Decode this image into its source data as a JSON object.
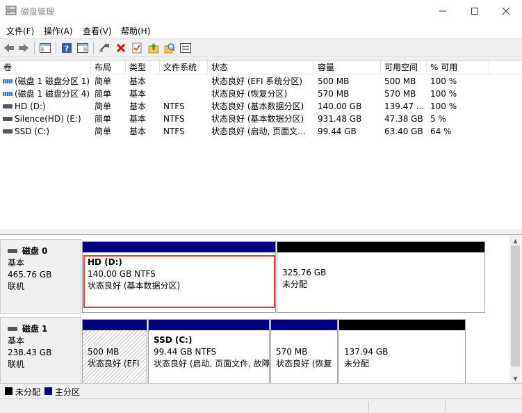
{
  "window": {
    "title": "磁盘管理",
    "icon": "disk-management-icon"
  },
  "menu": [
    "文件(F)",
    "操作(A)",
    "查看(V)",
    "帮助(H)"
  ],
  "toolbar": {
    "buttons": [
      "back-arrow-icon",
      "forward-arrow-icon",
      "console-tree-icon",
      "help-icon",
      "properties-icon",
      "connect-disk-icon",
      "delete-icon",
      "check-icon",
      "up-folder-icon",
      "search-icon",
      "list-icon"
    ]
  },
  "volume_table": {
    "columns": [
      "卷",
      "布局",
      "类型",
      "文件系统",
      "状态",
      "容量",
      "可用空间",
      "% 可用"
    ],
    "rows": [
      {
        "volume": "(磁盘 1 磁盘分区 1)",
        "layout": "简单",
        "type": "基本",
        "fs": "",
        "status": "状态良好 (EFI 系统分区)",
        "capacity": "500 MB",
        "free": "500 MB",
        "pct": "100 %",
        "icon": "system-partition-icon"
      },
      {
        "volume": "(磁盘 1 磁盘分区 4)",
        "layout": "简单",
        "type": "基本",
        "fs": "",
        "status": "状态良好 (恢复分区)",
        "capacity": "570 MB",
        "free": "570 MB",
        "pct": "100 %",
        "icon": "system-partition-icon"
      },
      {
        "volume": "HD (D:)",
        "layout": "简单",
        "type": "基本",
        "fs": "NTFS",
        "status": "状态良好 (基本数据分区)",
        "capacity": "140.00 GB",
        "free": "139.47 ...",
        "pct": "100 %",
        "icon": "drive-icon"
      },
      {
        "volume": "Silence(HD) (E:)",
        "layout": "简单",
        "type": "基本",
        "fs": "NTFS",
        "status": "状态良好 (基本数据分区)",
        "capacity": "931.48 GB",
        "free": "47.38 GB",
        "pct": "5 %",
        "icon": "drive-icon"
      },
      {
        "volume": "SSD (C:)",
        "layout": "简单",
        "type": "基本",
        "fs": "NTFS",
        "status": "状态良好 (启动, 页面文...",
        "capacity": "99.44 GB",
        "free": "63.40 GB",
        "pct": "64 %",
        "icon": "drive-icon"
      }
    ]
  },
  "disks": [
    {
      "name": "磁盘 0",
      "type": "基本",
      "size": "465.76 GB",
      "state": "联机",
      "partitions": [
        {
          "title": "HD   (D:)",
          "line1": "140.00 GB NTFS",
          "line2": "状态良好 (基本数据分区)",
          "kind": "primary",
          "selected": true
        },
        {
          "title": "",
          "line1": "325.76 GB",
          "line2": "未分配",
          "kind": "unallocated",
          "selected": false
        }
      ]
    },
    {
      "name": "磁盘 1",
      "type": "基本",
      "size": "238.43 GB",
      "state": "联机",
      "partitions": [
        {
          "title": "",
          "line1": "500 MB",
          "line2": "状态良好 (EFI",
          "kind": "primary",
          "selected": false
        },
        {
          "title": "SSD   (C:)",
          "line1": "99.44 GB NTFS",
          "line2": "状态良好 (启动, 页面文件, 故障",
          "kind": "primary",
          "selected": false
        },
        {
          "title": "",
          "line1": "570 MB",
          "line2": "状态良好 (恢复",
          "kind": "primary",
          "selected": false
        },
        {
          "title": "",
          "line1": "137.94 GB",
          "line2": "未分配",
          "kind": "unallocated",
          "selected": false
        }
      ]
    }
  ],
  "legend": [
    {
      "label": "未分配",
      "color": "#000000"
    },
    {
      "label": "主分区",
      "color": "#000080"
    }
  ]
}
